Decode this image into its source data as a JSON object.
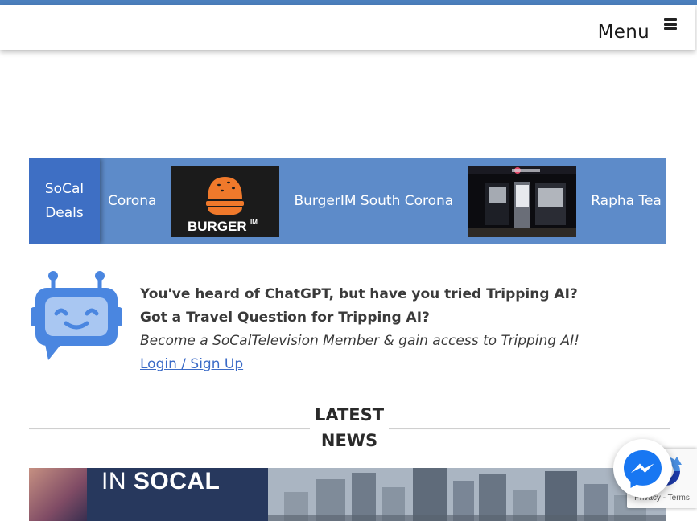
{
  "nav": {
    "menu_label": "Menu",
    "menu_icon": "hamburger-icon"
  },
  "deals": {
    "tab_label_line1": "SoCal",
    "tab_label_line2": "Deals",
    "items": [
      {
        "label": "Corona"
      },
      {
        "image": "burgerim-logo",
        "image_text": "BURGER",
        "image_text_suffix": "IM"
      },
      {
        "label": "BurgerIM South Corona"
      },
      {
        "image": "rapha-tea-storefront"
      },
      {
        "label": "Rapha Tea Corona"
      }
    ]
  },
  "ai": {
    "icon": "robot-icon",
    "line1": "You've heard of ChatGPT, but have you tried Tripping AI?",
    "line2": "Got a Travel Question for Tripping AI?",
    "line3": "Become a SoCalTelevision Member & gain access to Tripping AI!",
    "link": "Login / Sign Up"
  },
  "news": {
    "title_line1": "LATEST",
    "title_line2": "NEWS"
  },
  "banner": {
    "word1": "IN",
    "word2": "SOCAL"
  },
  "recaptcha": {
    "icon": "recaptcha-icon",
    "privacy": "Privacy",
    "separator": " - ",
    "terms": "Terms"
  },
  "messenger": {
    "icon": "messenger-icon"
  },
  "colors": {
    "accent_blue": "#4b7fbd",
    "deals_bar": "#5d8bc9",
    "deals_tab": "#3e6fc4",
    "robot_blue": "#4a86e0",
    "link_blue": "#3b6bc7",
    "messenger_blue": "#1877f2"
  }
}
